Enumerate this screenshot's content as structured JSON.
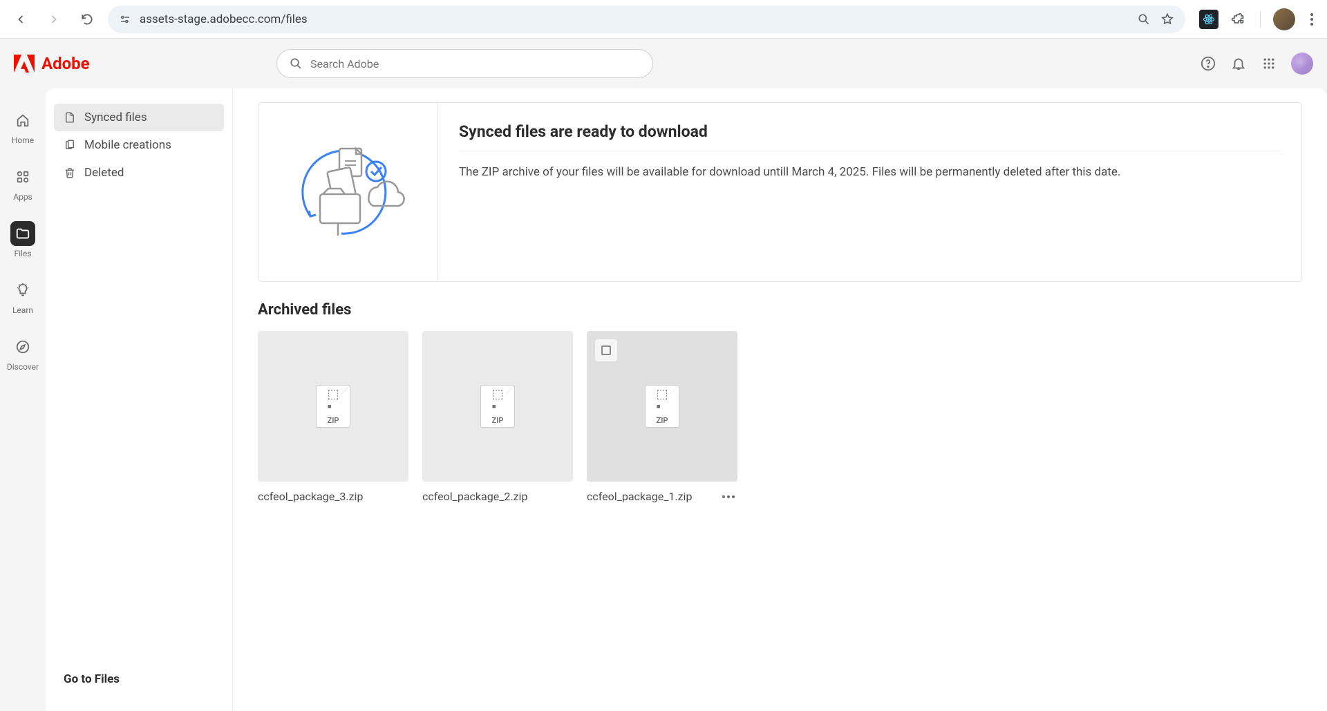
{
  "browser": {
    "url": "assets-stage.adobecc.com/files"
  },
  "header": {
    "brand": "Adobe",
    "search_placeholder": "Search Adobe"
  },
  "rail": {
    "items": [
      {
        "label": "Home"
      },
      {
        "label": "Apps"
      },
      {
        "label": "Files"
      },
      {
        "label": "Learn"
      },
      {
        "label": "Discover"
      }
    ]
  },
  "sidebar": {
    "items": [
      {
        "label": "Synced files"
      },
      {
        "label": "Mobile creations"
      },
      {
        "label": "Deleted"
      }
    ],
    "footer": "Go to Files"
  },
  "banner": {
    "title": "Synced files are ready to download",
    "body": "The ZIP archive of your files will be available for download untill March 4, 2025. Files will be permanently deleted after this date."
  },
  "archived": {
    "title": "Archived files",
    "files": [
      {
        "name": "ccfeol_package_3.zip",
        "type": "ZIP"
      },
      {
        "name": "ccfeol_package_2.zip",
        "type": "ZIP"
      },
      {
        "name": "ccfeol_package_1.zip",
        "type": "ZIP"
      }
    ]
  }
}
